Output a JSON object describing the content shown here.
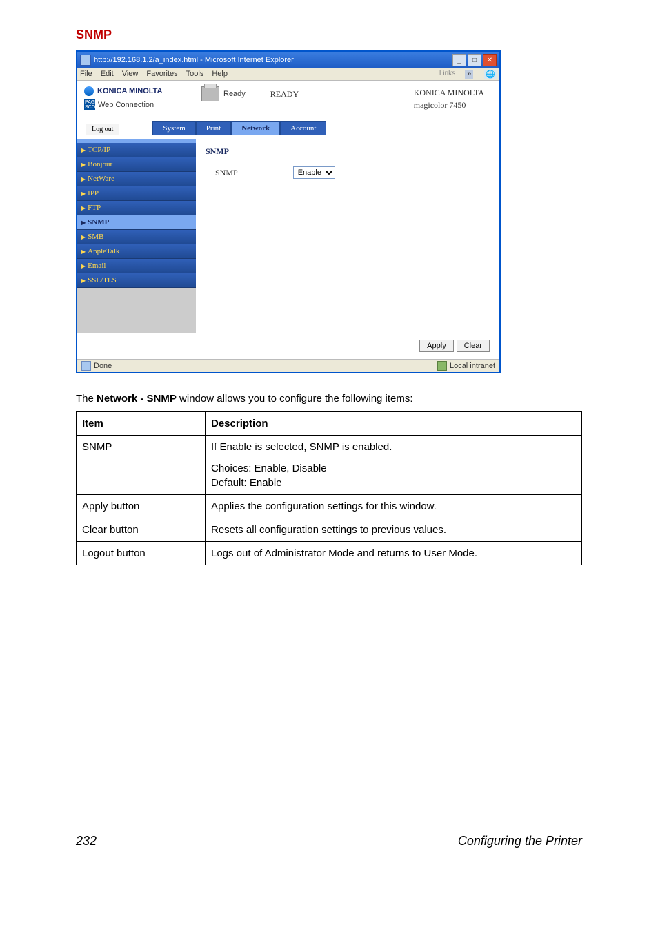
{
  "section_title": "SNMP",
  "browser": {
    "title": "http://192.168.1.2/a_index.html - Microsoft Internet Explorer",
    "menu": [
      "File",
      "Edit",
      "View",
      "Favorites",
      "Tools",
      "Help"
    ],
    "links_label": "Links",
    "brand": {
      "name": "KONICA MINOLTA",
      "pagescope": "PAGE SCOPE",
      "webconn": "Web Connection"
    },
    "status": {
      "ready_small": "Ready",
      "ready_big": "READY"
    },
    "right_info": {
      "line1": "KONICA MINOLTA",
      "line2": "magicolor 7450"
    },
    "logout": "Log out",
    "tabs": [
      "System",
      "Print",
      "Network",
      "Account"
    ],
    "active_tab": 2,
    "sidebar": [
      {
        "label": "TCP/IP"
      },
      {
        "label": "Bonjour"
      },
      {
        "label": "NetWare"
      },
      {
        "label": "IPP"
      },
      {
        "label": "FTP"
      },
      {
        "label": "SNMP",
        "selected": true
      },
      {
        "label": "SMB"
      },
      {
        "label": "AppleTalk"
      },
      {
        "label": "Email"
      },
      {
        "label": "SSL/TLS"
      }
    ],
    "pane": {
      "title": "SNMP",
      "field_label": "SNMP",
      "select_value": "Enable"
    },
    "buttons": {
      "apply": "Apply",
      "clear": "Clear"
    },
    "statusbar": {
      "done": "Done",
      "zone": "Local intranet"
    }
  },
  "intro_pre": "The ",
  "intro_bold": "Network - SNMP",
  "intro_post": " window allows you to configure the following items:",
  "table": {
    "head": {
      "item": "Item",
      "desc": "Description"
    },
    "rows": [
      {
        "item": "SNMP",
        "desc_line1": "If Enable is selected, SNMP is enabled.",
        "desc_line2": "Choices: Enable, Disable",
        "desc_line3": "Default:  Enable"
      },
      {
        "item": "Apply button",
        "desc": "Applies the configuration settings for this window."
      },
      {
        "item": "Clear button",
        "desc": "Resets all configuration settings to previous values."
      },
      {
        "item": "Logout button",
        "desc": "Logs out of Administrator Mode and returns to User Mode."
      }
    ]
  },
  "footer": {
    "page": "232",
    "title": "Configuring the Printer"
  }
}
